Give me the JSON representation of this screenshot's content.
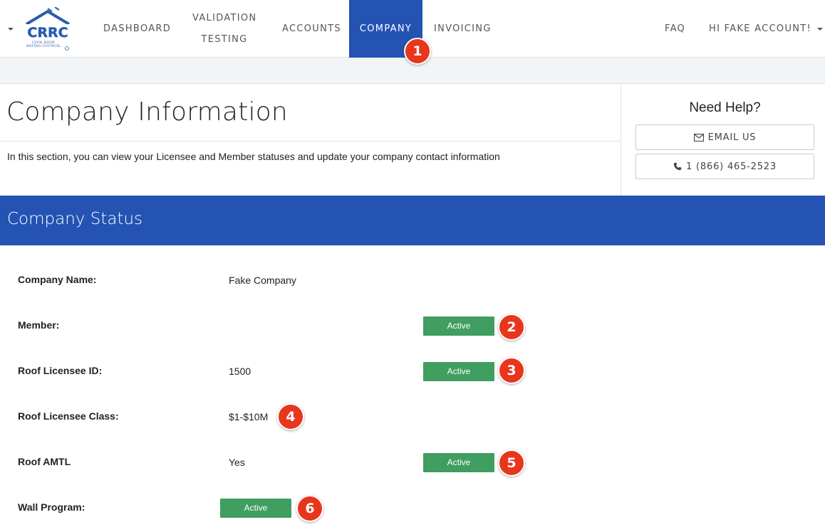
{
  "nav": {
    "logo_text": "CRRC",
    "logo_subtext": "COOL ROOF RATING COUNCIL",
    "dashboard": "DASHBOARD",
    "validation_line1": "VALIDATION",
    "validation_line2": "TESTING",
    "accounts": "ACCOUNTS",
    "company": "COMPANY",
    "invoicing": "INVOICING",
    "faq": "FAQ",
    "user": "HI FAKE ACCOUNT!"
  },
  "header": {
    "title": "Company Information",
    "intro": "In this section, you can view your Licensee and Member statuses and update your company contact information"
  },
  "help": {
    "title": "Need Help?",
    "email_label": "EMAIL US",
    "phone_label": "1 (866) 465-2523",
    "email_icon": "envelope-icon",
    "phone_icon": "phone-icon"
  },
  "status": {
    "banner_title": "Company Status",
    "rows": [
      {
        "label": "Company Name:",
        "value": "Fake Company",
        "badge": ""
      },
      {
        "label": "Member:",
        "value": "",
        "badge": "Active"
      },
      {
        "label": "Roof Licensee ID:",
        "value": "1500",
        "badge": "Active"
      },
      {
        "label": "Roof Licensee Class:",
        "value": "$1-$10M",
        "badge": ""
      },
      {
        "label": "Roof AMTL",
        "value": "Yes",
        "badge": "Active"
      },
      {
        "label": "Wall Program:",
        "value": "",
        "badge": "Active"
      }
    ]
  },
  "callouts": [
    "1",
    "2",
    "3",
    "4",
    "5",
    "6"
  ],
  "colors": {
    "brand_blue": "#2453b4",
    "active_green": "#3f9e60",
    "callout_red": "#e8361d"
  }
}
